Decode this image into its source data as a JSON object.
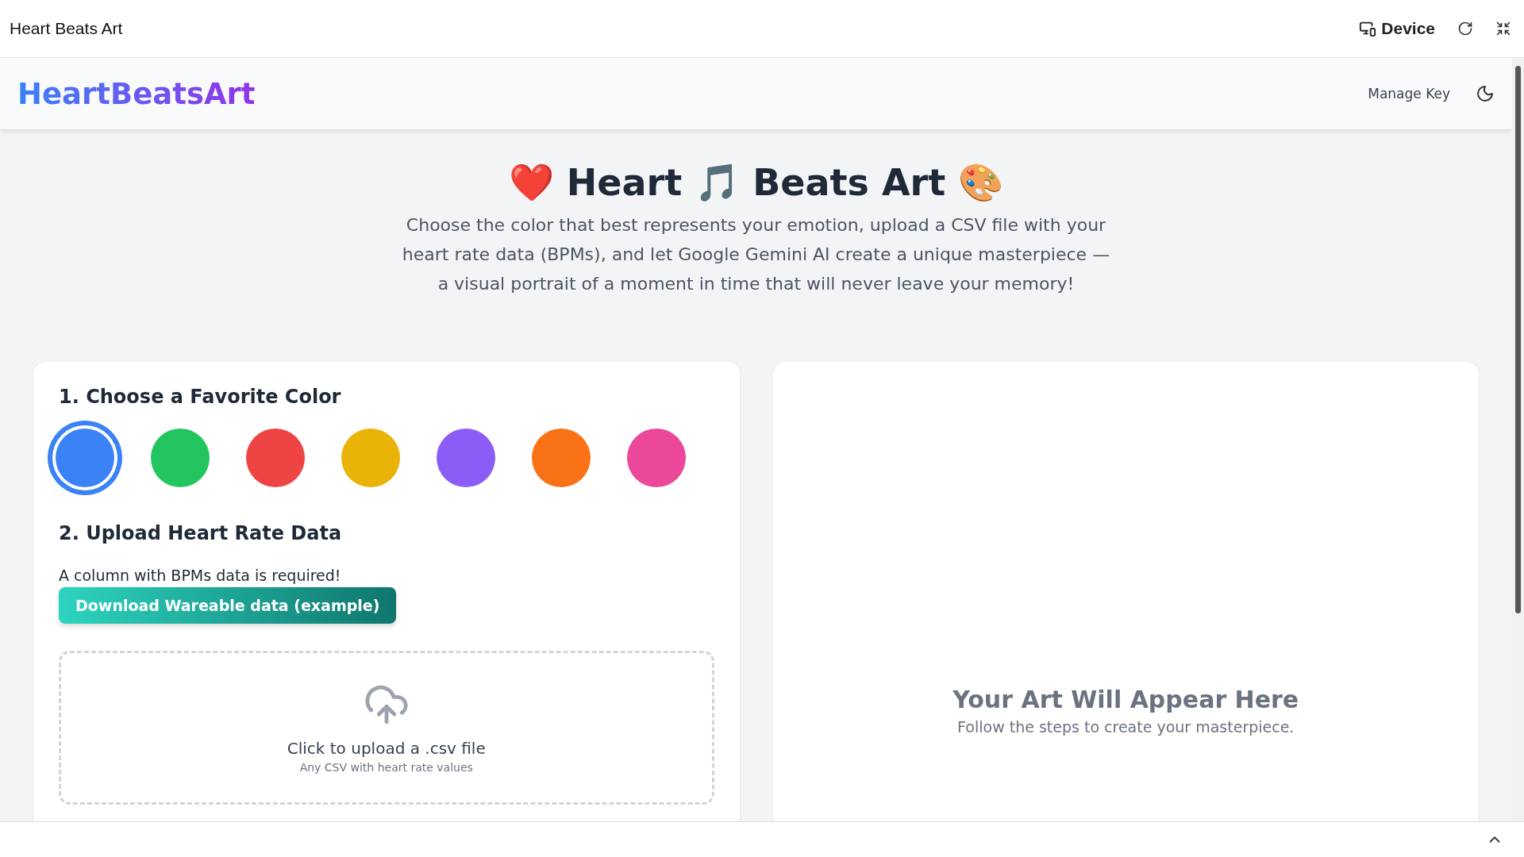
{
  "browser_bar": {
    "title": "Heart Beats Art",
    "device_label": "Device"
  },
  "header": {
    "logo": "HeartBeatsArt",
    "manage_key": "Manage Key"
  },
  "hero": {
    "title": "❤️ Heart 🎵 Beats Art 🎨",
    "description": "Choose the color that best represents your emotion, upload a CSV file with your heart rate data (BPMs), and let Google Gemini AI create a unique masterpiece — a visual portrait of a moment in time that will never leave your memory!"
  },
  "color_step": {
    "heading": "1. Choose a Favorite Color",
    "colors": [
      {
        "color": "#3b82f6",
        "selected": true
      },
      {
        "color": "#22c55e",
        "selected": false
      },
      {
        "color": "#ef4444",
        "selected": false
      },
      {
        "color": "#eab308",
        "selected": false
      },
      {
        "color": "#8b5cf6",
        "selected": false
      },
      {
        "color": "#f97316",
        "selected": false
      },
      {
        "color": "#ec4899",
        "selected": false
      }
    ]
  },
  "upload_step": {
    "heading": "2. Upload Heart Rate Data",
    "note": "A column with BPMs data is required!",
    "download_button": "Download Wareable data (example)",
    "dropzone_title": "Click to upload a .csv file",
    "dropzone_hint": "Any CSV with heart rate values"
  },
  "art_panel": {
    "title": "Your Art Will Appear Here",
    "subtitle": "Follow the steps to create your masterpiece."
  }
}
